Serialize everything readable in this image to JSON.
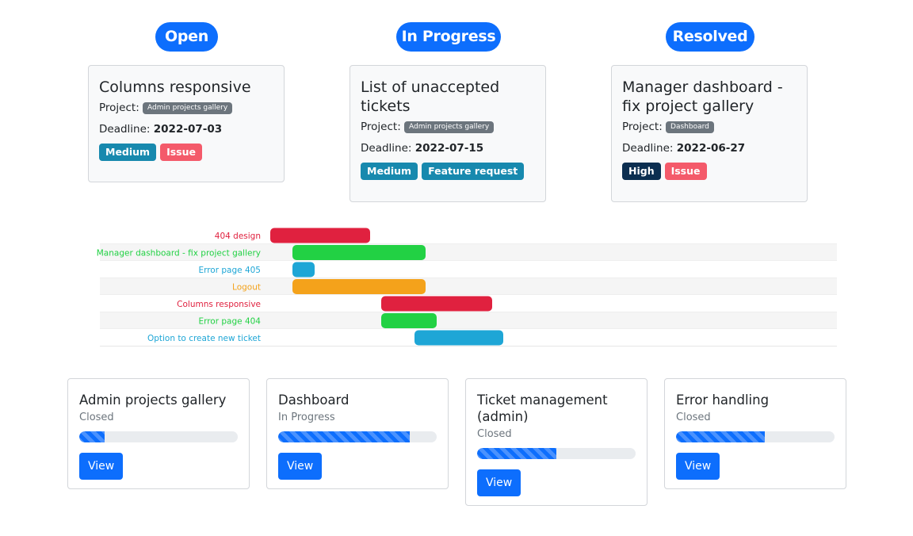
{
  "columns": [
    {
      "heading": "Open",
      "ticket": {
        "title": "Columns responsive",
        "project_label": "Project:",
        "project": "Admin projects gallery",
        "deadline_label": "Deadline:",
        "deadline": "2022-07-03",
        "tags": [
          {
            "label": "Medium",
            "color": "#1789ae"
          },
          {
            "label": "Issue",
            "color": "#f45a6a"
          }
        ]
      }
    },
    {
      "heading": "In Progress",
      "ticket": {
        "title": "List of unaccepted tickets",
        "project_label": "Project:",
        "project": "Admin projects gallery",
        "deadline_label": "Deadline:",
        "deadline": "2022-07-15",
        "tags": [
          {
            "label": "Medium",
            "color": "#1789ae"
          },
          {
            "label": "Feature request",
            "color": "#1789ae"
          }
        ]
      }
    },
    {
      "heading": "Resolved",
      "ticket": {
        "title": "Manager dashboard - fix project gallery",
        "project_label": "Project:",
        "project": "Dashboard",
        "deadline_label": "Deadline:",
        "deadline": "2022-06-27",
        "tags": [
          {
            "label": "High",
            "color": "#0b2e50"
          },
          {
            "label": "Issue",
            "color": "#f45a6a"
          }
        ]
      }
    }
  ],
  "chart_data": {
    "type": "gantt",
    "tasks": [
      {
        "name": "404 design",
        "color": "#e0213f",
        "start": 0,
        "end": 9
      },
      {
        "name": "Manager dashboard - fix project gallery",
        "color": "#22d144",
        "start": 2,
        "end": 14
      },
      {
        "name": "Error page 405",
        "color": "#1ea6d6",
        "start": 2,
        "end": 4
      },
      {
        "name": "Logout",
        "color": "#f4a21b",
        "start": 2,
        "end": 14
      },
      {
        "name": "Columns responsive",
        "color": "#e0213f",
        "start": 10,
        "end": 20
      },
      {
        "name": "Error page 404",
        "color": "#22d144",
        "start": 10,
        "end": 15
      },
      {
        "name": "Option to create new ticket",
        "color": "#1ea6d6",
        "start": 13,
        "end": 21
      }
    ]
  },
  "projects": [
    {
      "title": "Admin projects gallery",
      "status": "Closed",
      "progress": 0.16,
      "button": "View"
    },
    {
      "title": "Dashboard",
      "status": "In Progress",
      "progress": 0.83,
      "button": "View"
    },
    {
      "title": "Ticket management (admin)",
      "status": "Closed",
      "progress": 0.5,
      "button": "View"
    },
    {
      "title": "Error handling",
      "status": "Closed",
      "progress": 0.56,
      "button": "View"
    }
  ]
}
